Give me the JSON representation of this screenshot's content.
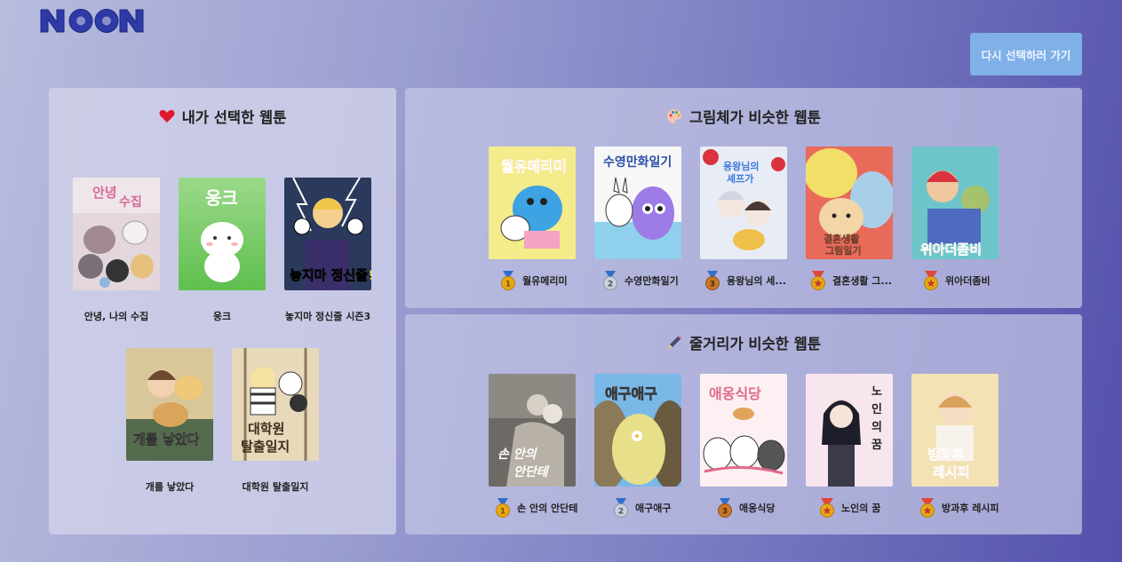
{
  "header": {
    "logo_text": "NOON",
    "back_button_label": "다시 선택하러 가기"
  },
  "my_picks": {
    "title": "내가 선택한 웹툰",
    "icon": "heart-icon",
    "items": [
      {
        "name": "안녕, 나의 수집",
        "cover_text": "안녕 나의 수집"
      },
      {
        "name": "웅크",
        "cover_text": "웅크"
      },
      {
        "name": "놓지마 정신줄 시즌3",
        "cover_text": "놓지마 정신줄!!"
      },
      {
        "name": "개를 낳았다",
        "cover_text": "개를 낳았다"
      },
      {
        "name": "대학원 탈출일지",
        "cover_text": "대학원 탈출일지"
      }
    ]
  },
  "similar_art": {
    "title": "그림체가 비슷한 웹툰",
    "icon": "palette-icon",
    "items": [
      {
        "rank": "1",
        "name": "월유메리미",
        "cover_text": "월유메리미"
      },
      {
        "rank": "2",
        "name": "수영만화일기",
        "cover_text": "수영만화일기"
      },
      {
        "rank": "3",
        "name": "용왕님의 세...",
        "cover_text": "용왕님의 셰프가 되었습니다"
      },
      {
        "rank": "",
        "name": "결혼생활 그...",
        "cover_text": "결혼생활 그림일기"
      },
      {
        "rank": "",
        "name": "위아더좀비",
        "cover_text": "위아더좀비"
      }
    ]
  },
  "similar_story": {
    "title": "줄거리가 비슷한 웹툰",
    "icon": "pen-icon",
    "items": [
      {
        "rank": "1",
        "name": "손 안의 안단테",
        "cover_text": "손 안의 안단테"
      },
      {
        "rank": "2",
        "name": "애구애구",
        "cover_text": "애구애구"
      },
      {
        "rank": "3",
        "name": "애옹식당",
        "cover_text": "애옹식당"
      },
      {
        "rank": "",
        "name": "노인의 꿈",
        "cover_text": "노인의 꿈"
      },
      {
        "rank": "",
        "name": "방과후 레시피",
        "cover_text": "방과후 레시피"
      }
    ]
  },
  "colors": {
    "accent_button": "#7fb0e8",
    "logo": "#2e3aa6",
    "gold": "#e6a817",
    "silver": "#a9b3c2",
    "bronze": "#c9772a"
  }
}
